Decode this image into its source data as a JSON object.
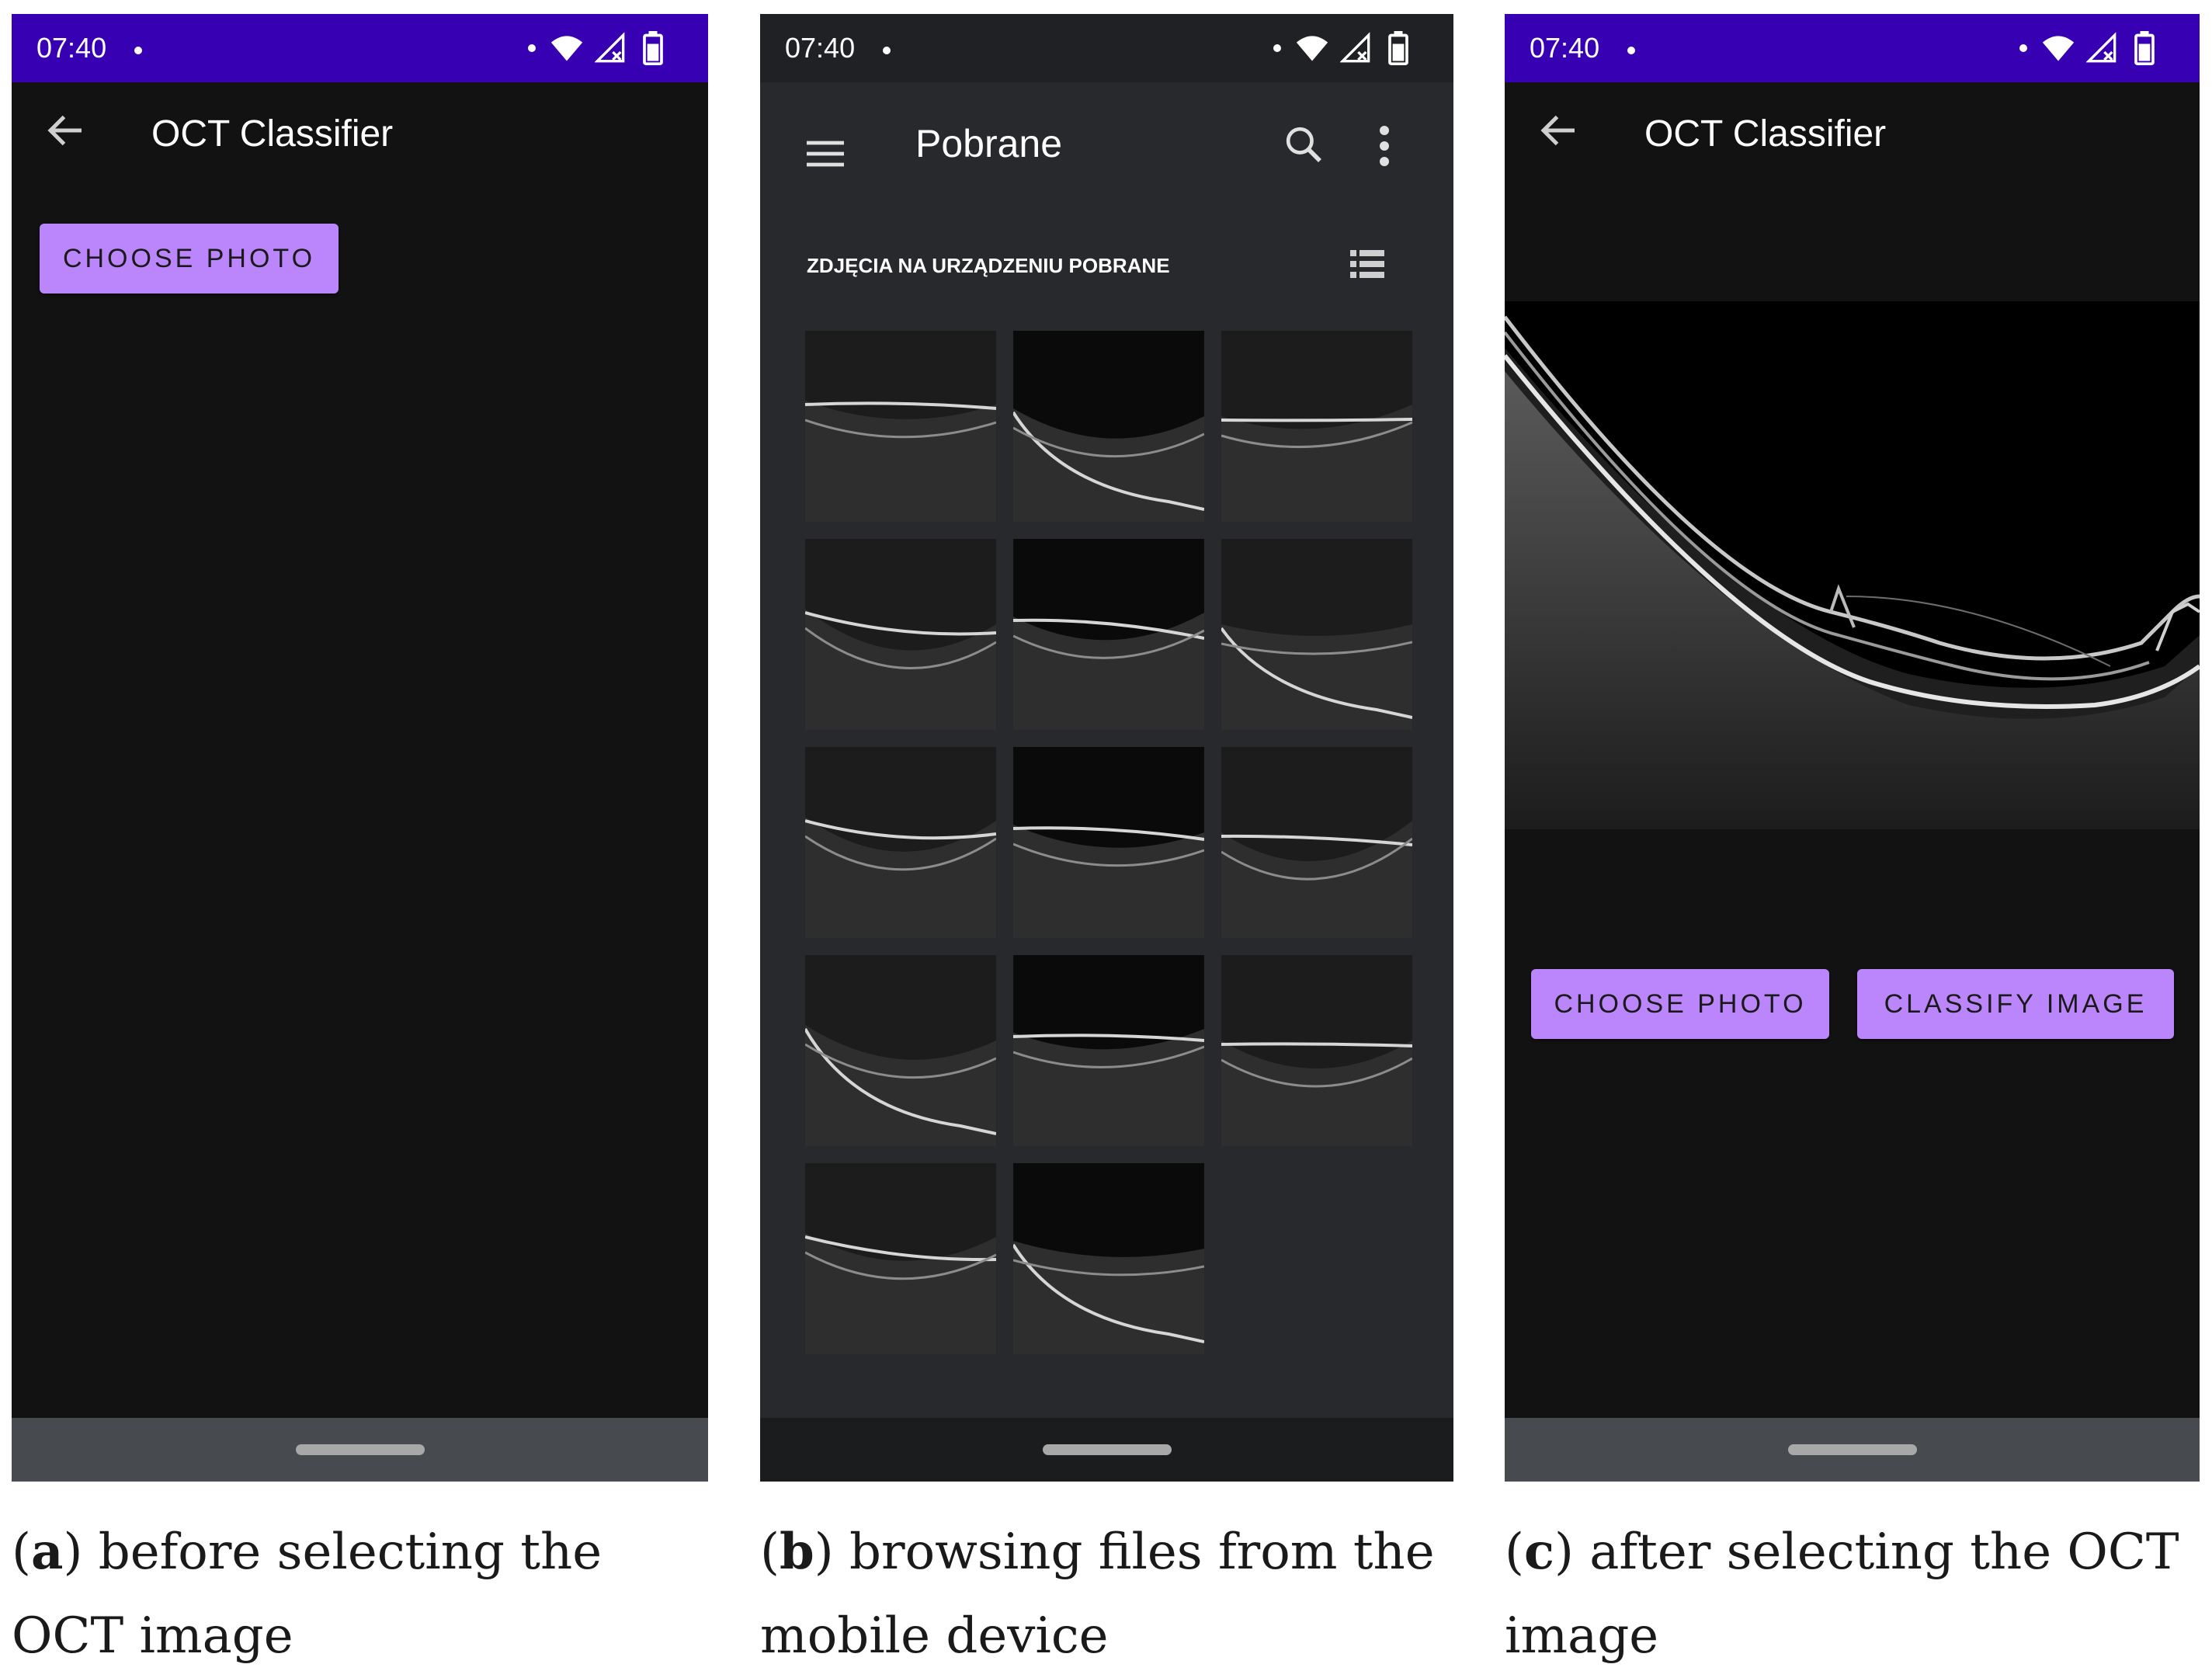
{
  "status_bar": {
    "time": "07:40"
  },
  "screen_a": {
    "app_title": "OCT Classifier",
    "choose_photo_label": "CHOOSE PHOTO"
  },
  "screen_b": {
    "title": "Pobrane",
    "section_header": "ZDJĘCIA NA URZĄDZENIU POBRANE",
    "thumbnail_count": 14
  },
  "screen_c": {
    "app_title": "OCT Classifier",
    "choose_photo_label": "CHOOSE PHOTO",
    "classify_label": "CLASSIFY IMAGE"
  },
  "captions": {
    "a": {
      "letter": "a",
      "text": "before selecting the OCT image"
    },
    "b": {
      "letter": "b",
      "text": "browsing files from the mobile device"
    },
    "c": {
      "letter": "c",
      "text": "after selecting the OCT image"
    }
  },
  "colors": {
    "status_bar": "#3700b3",
    "accent_button": "#bb86fc",
    "app_background": "#121212",
    "file_browser_background": "#28292c"
  }
}
